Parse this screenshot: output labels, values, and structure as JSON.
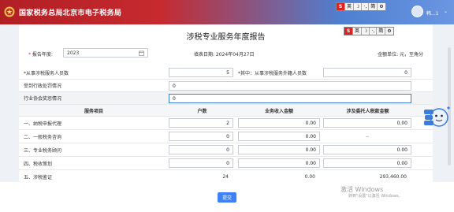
{
  "header": {
    "brand": "国家税务总局北京市电子税务局",
    "user_name": "韩...1",
    "caret": "⌄",
    "ime": {
      "s": "S",
      "t1": "英",
      "t2": "☽",
      "t3": "·,",
      "t4": "简",
      "t5": "⚙"
    }
  },
  "form": {
    "title": "涉税专业服务年度报告",
    "report_year_label": "报告年度:",
    "report_year_value": "2023",
    "fill_date": "填表日期:  2024年04月27日",
    "unit": "金额单位:  元，至角分"
  },
  "rows": {
    "staff_label": "*从事涉税服务人员数",
    "staff_value": "5",
    "foreign_label": "*其中：从事涉税服务外籍人员数",
    "foreign_value": "0",
    "admin_penalty_label": "受到行政处罚情况",
    "admin_penalty_value": "0",
    "industry_label": "行业协会奖惩情况",
    "industry_value": "0"
  },
  "table": {
    "headers": {
      "item": "服务项目",
      "count": "户数",
      "income": "业务收入金额",
      "tax": "涉及委托人税款金额"
    },
    "items": [
      {
        "name": "一、纳税申报代理",
        "count": "2",
        "income": "0.00",
        "tax": "0.00"
      },
      {
        "name": "二、一般税务咨询",
        "count": "0",
        "income": "0.00",
        "tax": "--"
      },
      {
        "name": "三、专业税务顾问",
        "count": "0",
        "income": "0.00",
        "tax": "0.00"
      },
      {
        "name": "四、税收策划",
        "count": "0",
        "income": "0.00",
        "tax": "0.00"
      },
      {
        "name": "五、涉税鉴证",
        "count": "24",
        "income": "0.00",
        "tax": "293,460.00"
      }
    ]
  },
  "footer": {
    "submit": "提交"
  },
  "watermark": {
    "line1": "激活 Windows",
    "line2": "转到\"设置\"以激活 Windows。"
  }
}
